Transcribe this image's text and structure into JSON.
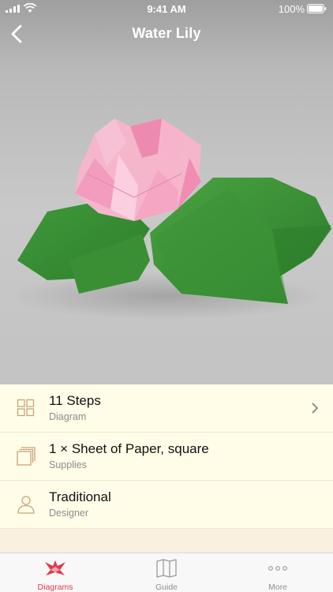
{
  "status_bar": {
    "time": "9:41 AM",
    "battery_percent": "100%",
    "battery_level": 1.0,
    "signal_icon": "signal-bars-icon",
    "wifi_icon": "wifi-icon"
  },
  "nav": {
    "title": "Water Lily",
    "back_icon": "chevron-left-icon"
  },
  "details": [
    {
      "primary": "11 Steps",
      "secondary": "Diagram",
      "icon": "grid-icon",
      "has_chevron": true
    },
    {
      "primary": "1 × Sheet of Paper, square",
      "secondary": "Supplies",
      "icon": "paper-stack-icon",
      "has_chevron": false
    },
    {
      "primary": "Traditional",
      "secondary": "Designer",
      "icon": "person-icon",
      "has_chevron": false
    }
  ],
  "tabs": [
    {
      "label": "Diagrams",
      "icon": "crane-icon",
      "active": true
    },
    {
      "label": "Guide",
      "icon": "map-icon",
      "active": false
    },
    {
      "label": "More",
      "icon": "ellipsis-icon",
      "active": false
    }
  ],
  "colors": {
    "accent": "#e03a4e",
    "icon_tan": "#c9a27a",
    "list_background": "#fffde8"
  }
}
